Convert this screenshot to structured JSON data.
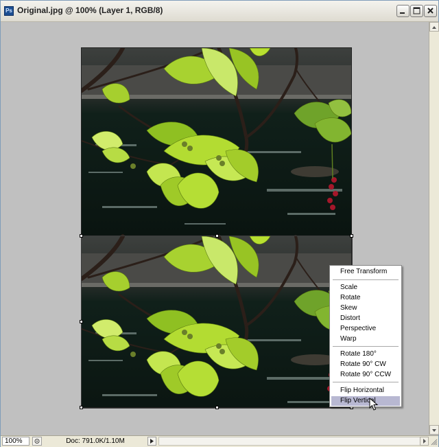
{
  "window": {
    "title": "Original.jpg @ 100% (Layer 1, RGB/8)",
    "app_icon_text": "Ps"
  },
  "context_menu": {
    "groups": [
      [
        {
          "label": "Free Transform"
        }
      ],
      [
        {
          "label": "Scale"
        },
        {
          "label": "Rotate"
        },
        {
          "label": "Skew"
        },
        {
          "label": "Distort"
        },
        {
          "label": "Perspective"
        },
        {
          "label": "Warp"
        }
      ],
      [
        {
          "label": "Rotate 180°"
        },
        {
          "label": "Rotate 90° CW"
        },
        {
          "label": "Rotate 90° CCW"
        }
      ],
      [
        {
          "label": "Flip Horizontal"
        },
        {
          "label": "Flip Vertical"
        }
      ]
    ],
    "selected": "Flip Vertical"
  },
  "status": {
    "zoom": "100%",
    "doc_info": "Doc: 791.0K/1.10M"
  },
  "colors": {
    "canvas_bg": "#c0c0c0",
    "menu_highlight": "#b8b8d2",
    "leaf_bright": "#b8e030",
    "water_dark": "#0e1612"
  }
}
